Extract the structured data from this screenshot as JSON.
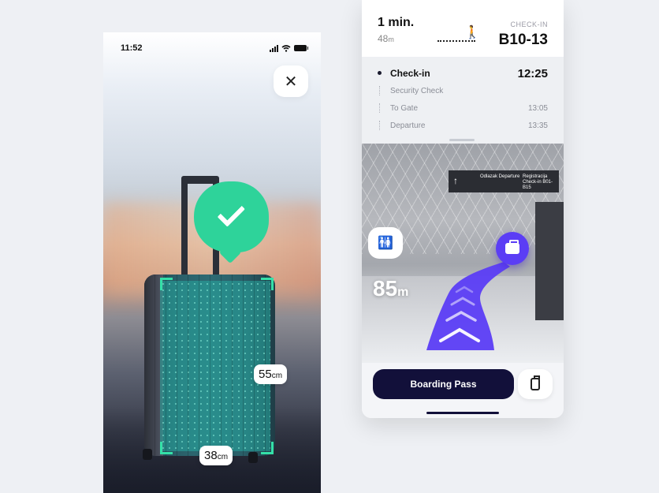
{
  "left_screen": {
    "status": {
      "time": "11:52"
    },
    "close_icon": "close-icon",
    "check_icon": "checkmark-icon",
    "measure_height": {
      "value": "55",
      "unit": "cm"
    },
    "measure_width": {
      "value": "38",
      "unit": "cm"
    },
    "colors": {
      "check_green": "#2ed39a",
      "frame_green": "#34e0a8"
    }
  },
  "right_screen": {
    "header": {
      "time_label": "1 min.",
      "distance_value": "48",
      "distance_unit": "m",
      "walk_icon": "walking-person-icon",
      "checkin_label": "CHECK-IN",
      "checkin_gate": "B10-13"
    },
    "timeline": [
      {
        "label": "Check-in",
        "time": "12:25",
        "active": true
      },
      {
        "label": "Security Check",
        "time": ""
      },
      {
        "label": "To Gate",
        "time": "13:05"
      },
      {
        "label": "Departure",
        "time": "13:35"
      }
    ],
    "ar": {
      "sign_arrow": "↑",
      "sign_text_1": "Odlazak Departure",
      "sign_text_2": "Registracija Check-in B01-B15",
      "restroom_icon": "restroom-icon",
      "distance_value": "85",
      "distance_unit": "m",
      "bag_icon": "baggage-icon"
    },
    "bottom": {
      "boarding_label": "Boarding Pass",
      "luggage_icon": "luggage-icon"
    },
    "colors": {
      "accent_purple": "#5b3df5",
      "button_dark": "#12103a"
    }
  }
}
